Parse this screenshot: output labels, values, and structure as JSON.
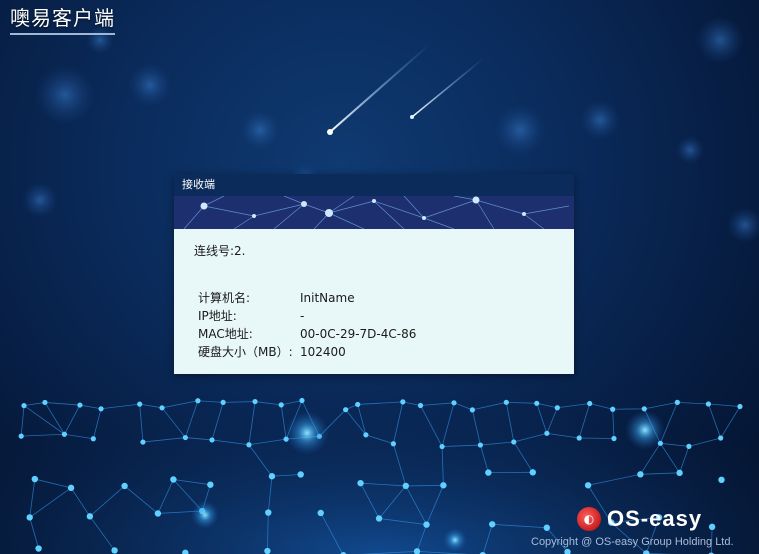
{
  "app": {
    "title": "噢易客户端"
  },
  "dialog": {
    "title": "接收端",
    "connection_label": "连线号:2.",
    "info": [
      {
        "label": "计算机名:",
        "value": "InitName"
      },
      {
        "label": "IP地址:",
        "value": "-"
      },
      {
        "label": "MAC地址:",
        "value": "00-0C-29-7D-4C-86"
      },
      {
        "label": "硬盘大小（MB）:",
        "value": "102400"
      }
    ]
  },
  "footer": {
    "brand": "OS-easy",
    "copyright": "Copyright @ OS-easy Group Holding Ltd."
  },
  "colors": {
    "background": "#0a2a5a",
    "dialog_title_bar": "#0b2c5a",
    "dialog_body": "#e8f8f8",
    "network_glow": "#4fc8ff",
    "logo_red": "#c81e1e"
  }
}
